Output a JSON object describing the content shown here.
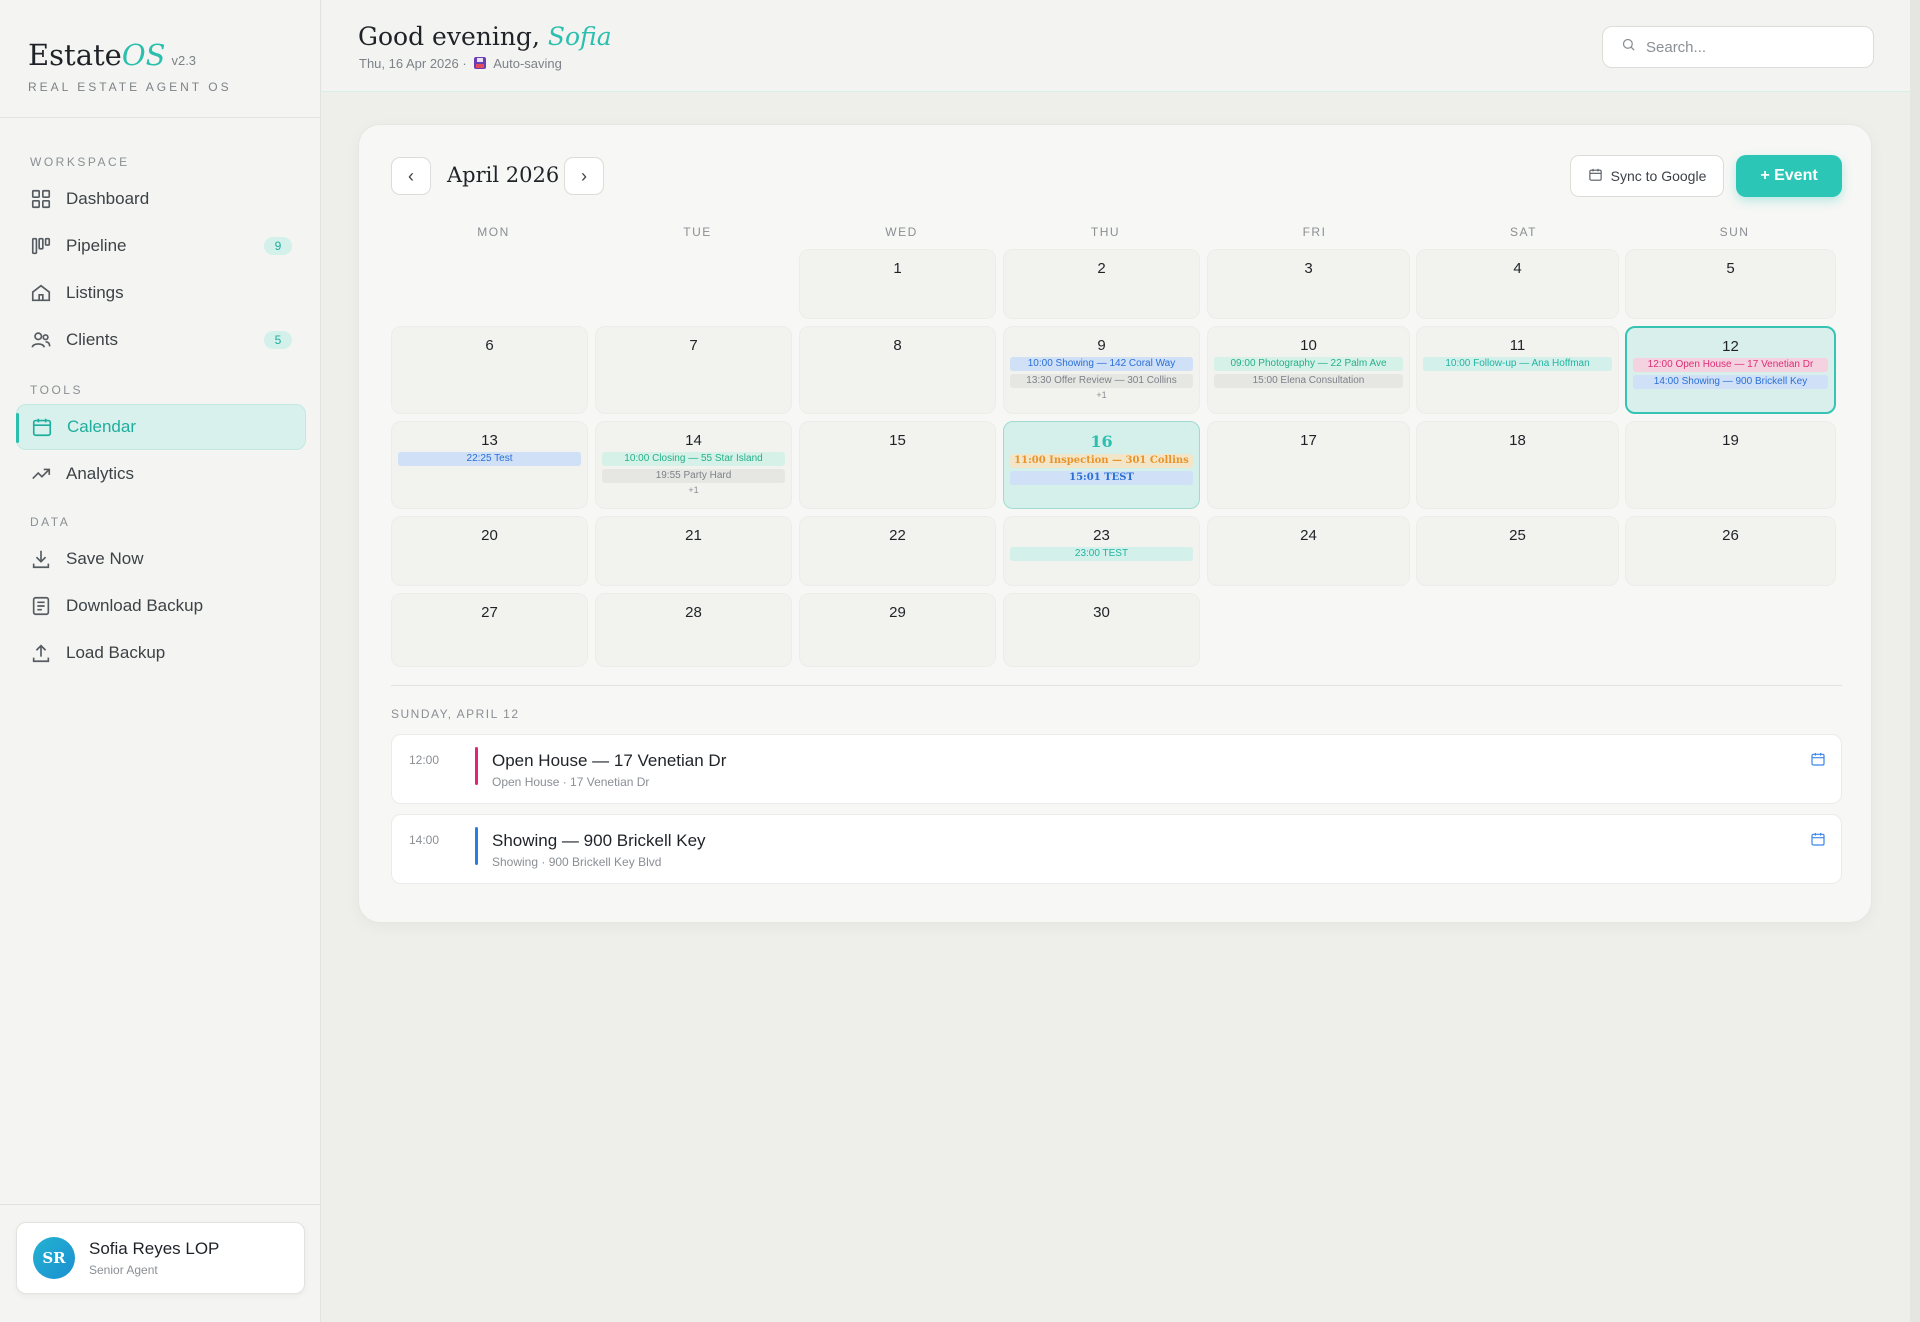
{
  "brand": {
    "name": "Estate",
    "name_accent": "OS",
    "version": "v2.3",
    "tagline": "REAL ESTATE AGENT OS"
  },
  "sidebar": {
    "sections": {
      "workspace": "WORKSPACE",
      "tools": "TOOLS",
      "data": "DATA"
    },
    "items": [
      {
        "label": "Dashboard",
        "icon": "grid-icon"
      },
      {
        "label": "Pipeline",
        "icon": "pipeline-icon",
        "badge": "9"
      },
      {
        "label": "Listings",
        "icon": "home-icon"
      },
      {
        "label": "Clients",
        "icon": "users-icon",
        "badge": "5"
      },
      {
        "label": "Calendar",
        "icon": "calendar-icon",
        "active": true
      },
      {
        "label": "Analytics",
        "icon": "trend-icon"
      },
      {
        "label": "Save Now",
        "icon": "download-icon"
      },
      {
        "label": "Download Backup",
        "icon": "document-icon"
      },
      {
        "label": "Load Backup",
        "icon": "upload-icon"
      }
    ]
  },
  "user": {
    "initials": "SR",
    "name": "Sofia Reyes LOP",
    "role": "Senior Agent"
  },
  "header": {
    "greeting": "Good evening,",
    "name": "Sofia",
    "date": "Thu, 16 Apr 2026 ·",
    "autosave": "Auto-saving"
  },
  "search": {
    "placeholder": "Search..."
  },
  "calendar": {
    "month_title": "April 2026",
    "prev": "‹",
    "next": "›",
    "sync_label": "Sync to Google",
    "event_label": "+ Event",
    "weekdays": [
      "MON",
      "TUE",
      "WED",
      "THU",
      "FRI",
      "SAT",
      "SUN"
    ],
    "days": {
      "1": [],
      "2": [],
      "3": [],
      "4": [],
      "5": [],
      "6": [],
      "7": [],
      "8": [],
      "9": [
        {
          "text": "10:00 Showing — 142 Coral Way",
          "color": "blue"
        },
        {
          "text": "13:30 Offer Review — 301 Collins",
          "color": "gray"
        }
      ],
      "9_more": "+1",
      "10": [
        {
          "text": "09:00 Photography — 22 Palm Ave",
          "color": "green"
        },
        {
          "text": "15:00 Elena Consultation",
          "color": "gray"
        }
      ],
      "11": [
        {
          "text": "10:00 Follow-up — Ana Hoffman",
          "color": "teal"
        }
      ],
      "12": [
        {
          "text": "12:00 Open House — 17 Venetian Dr",
          "color": "pink"
        },
        {
          "text": "14:00 Showing — 900 Brickell Key",
          "color": "blue"
        }
      ],
      "13": [
        {
          "text": "22:25 Test",
          "color": "blue"
        }
      ],
      "14": [
        {
          "text": "10:00 Closing — 55 Star Island",
          "color": "green"
        },
        {
          "text": "19:55 Party Hard",
          "color": "gray"
        }
      ],
      "14_more": "+1",
      "16": [
        {
          "text": "11:00 Inspection — 301 Collins",
          "color": "orange"
        },
        {
          "text": "15:01 TEST",
          "color": "blue"
        }
      ],
      "23": [
        {
          "text": "23:00 TEST",
          "color": "teal"
        }
      ]
    }
  },
  "agenda": {
    "date_label": "SUNDAY, APRIL 12",
    "items": [
      {
        "time": "12:00",
        "title": "Open House — 17 Venetian Dr",
        "subtitle": "Open House · 17 Venetian Dr",
        "color": "#e0267a"
      },
      {
        "time": "14:00",
        "title": "Showing — 900 Brickell Key",
        "subtitle": "Showing · 900 Brickell Key Blvd",
        "color": "#2a7ee0"
      }
    ]
  },
  "colors": {
    "accent": "#2bbfae",
    "pink": "#e0267a",
    "blue": "#2a7ee0"
  }
}
